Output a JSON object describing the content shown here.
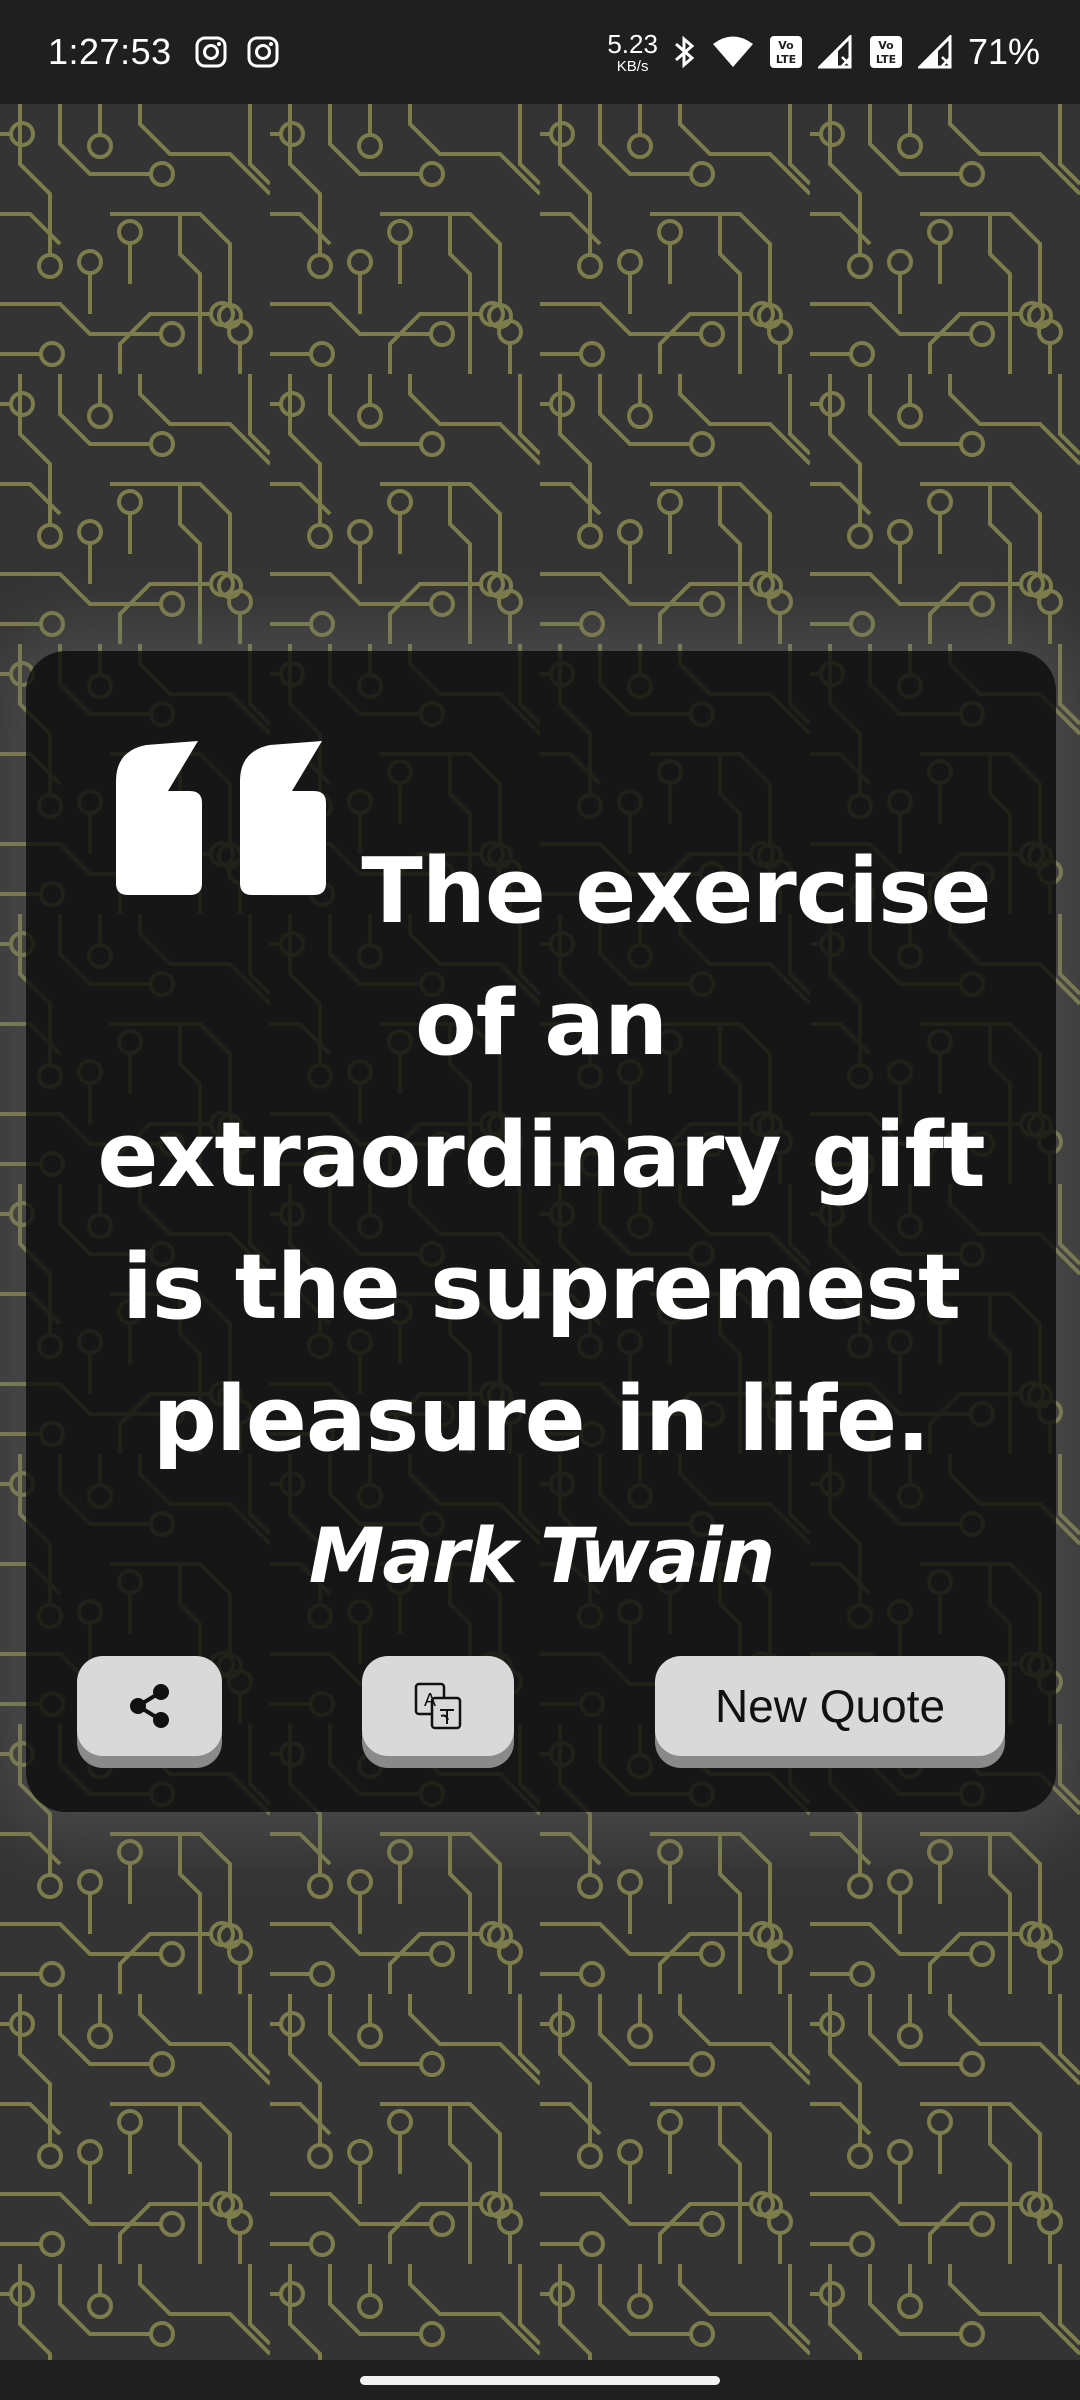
{
  "status_bar": {
    "time": "1:27:53",
    "left_icons": [
      "instagram-icon",
      "instagram-icon"
    ],
    "net_speed_value": "5.23",
    "net_speed_unit": "KB/s",
    "right_icons": [
      "bluetooth-icon",
      "wifi-icon",
      "volte-icon",
      "signal-icon",
      "volte-icon",
      "signal-icon"
    ],
    "battery": "71%"
  },
  "quote": {
    "text": "The exercise of an extraordinary gift is the supremest pleasure in life.",
    "author": "Mark Twain"
  },
  "actions": {
    "share_icon": "share-icon",
    "translate_icon": "translate-icon",
    "new_quote_label": "New Quote"
  },
  "colors": {
    "background": "#2e2e2e",
    "circuit_trace": "#8a8a55",
    "card": "#121212",
    "button": "#d9d9d9",
    "text": "#ffffff"
  }
}
